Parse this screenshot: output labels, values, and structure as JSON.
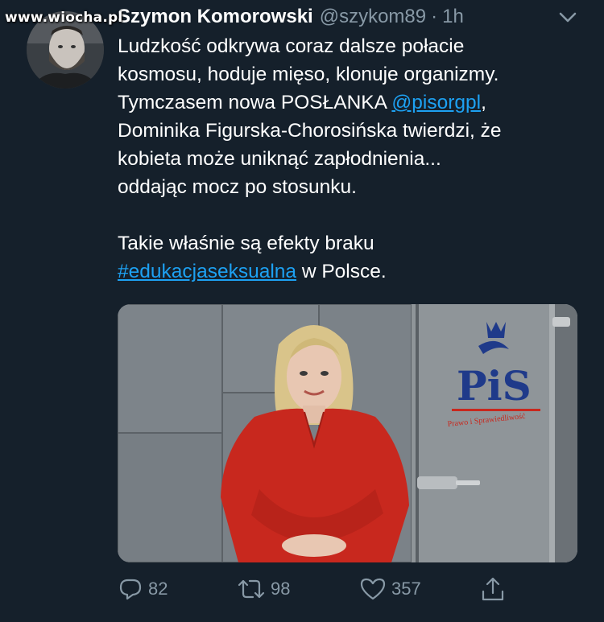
{
  "watermark": "www.wiocha.pl",
  "tweet": {
    "author_name": "Szymon Komorowski",
    "author_handle": "@szykom89",
    "separator": "·",
    "time": "1h",
    "lines": {
      "l1": "Ludzkość odkrywa coraz dalsze połacie",
      "l2": "kosmosu, hoduje mięso, klonuje organizmy.",
      "l3_pre": "Tymczasem nowa POSŁANKA ",
      "l3_link": "@pisorgpl",
      "l3_post": ",",
      "l4": "Dominika Figurska-Chorosińska twierdzi, że",
      "l5": "kobieta może uniknąć zapłodnienia...",
      "l6": "oddając mocz po stosunku.",
      "l7": "Takie właśnie są efekty braku",
      "l8_link": "#edukacjaseksualna",
      "l8_post": " w Polsce."
    },
    "media": {
      "logo_text": "PiS",
      "logo_subtext": "Prawo i Sprawiedliwość"
    }
  },
  "actions": {
    "reply_count": "82",
    "retweet_count": "98",
    "like_count": "357"
  },
  "colors": {
    "background": "#15202b",
    "secondary_text": "#8899a6",
    "link": "#1da1f2",
    "dress": "#c8281e"
  },
  "icons": [
    "chevron-down-icon",
    "reply-icon",
    "retweet-icon",
    "like-icon",
    "share-icon"
  ]
}
